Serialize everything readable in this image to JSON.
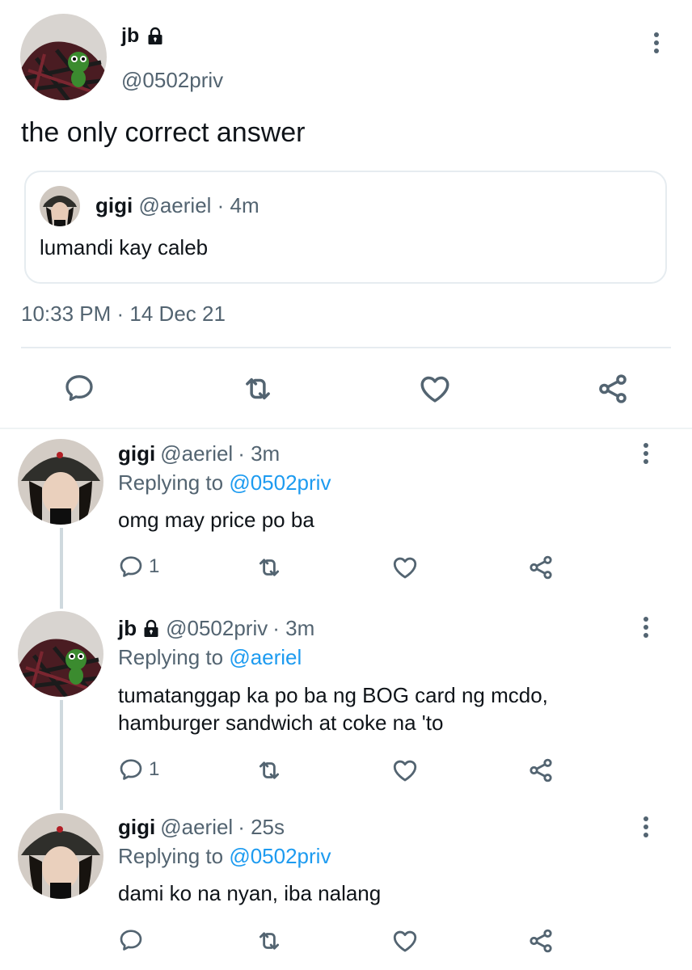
{
  "main_tweet": {
    "display_name": "jb",
    "handle": "@0502priv",
    "text": "the only correct answer",
    "timestamp": "10:33 PM · 14 Dec 21",
    "quoted": {
      "display_name": "gigi",
      "handle": "@aeriel",
      "age": "· 4m",
      "text": "lumandi kay caleb"
    }
  },
  "replies": [
    {
      "display_name": "gigi",
      "handle": "@aeriel",
      "age": "· 3m",
      "replying_label": "Replying to",
      "replying_to": "@0502priv",
      "text": "omg may price po ba",
      "reply_count": "1"
    },
    {
      "display_name": "jb",
      "handle": "@0502priv",
      "age": "· 3m",
      "replying_label": "Replying to",
      "replying_to": "@aeriel",
      "text": "tumatanggap ka po ba ng BOG card ng mcdo, hamburger sandwich at coke na 'to",
      "reply_count": "1"
    },
    {
      "display_name": "gigi",
      "handle": "@aeriel",
      "age": "· 25s",
      "replying_label": "Replying to",
      "replying_to": "@0502priv",
      "text": "dami ko na nyan, iba nalang",
      "reply_count": ""
    }
  ],
  "colors": {
    "accent": "#1d9bf0",
    "muted": "#536471",
    "text": "#0f1419",
    "divider": "#e6ecf0"
  },
  "icons": [
    "lock-icon",
    "more-icon",
    "reply-icon",
    "retweet-icon",
    "like-icon",
    "share-icon"
  ]
}
